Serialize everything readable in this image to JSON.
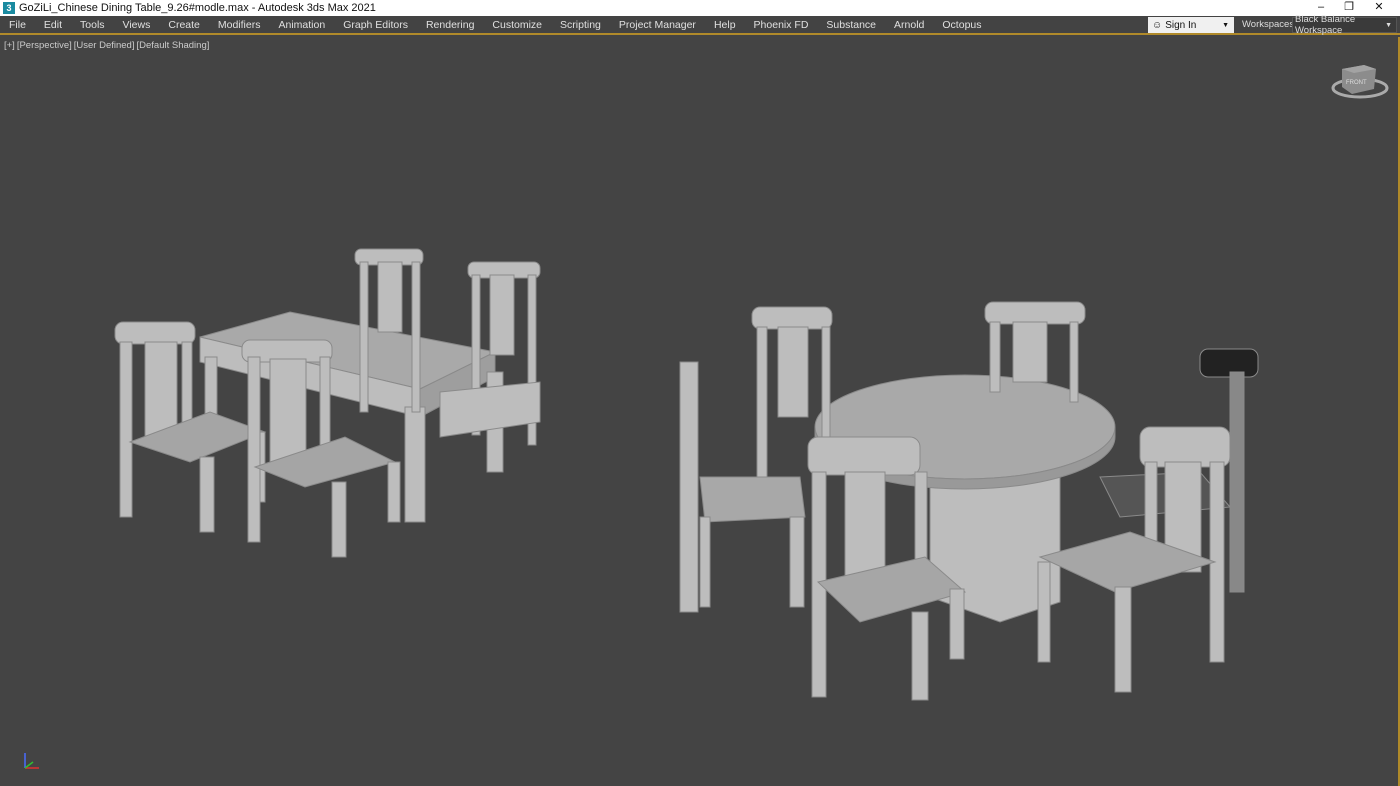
{
  "titlebar": {
    "app_icon": "3",
    "title": "GoZiLi_Chinese Dining Table_9.26#modle.max - Autodesk 3ds Max 2021",
    "minimize": "–",
    "restore": "❐",
    "close": "✕"
  },
  "menu": [
    "File",
    "Edit",
    "Tools",
    "Views",
    "Create",
    "Modifiers",
    "Animation",
    "Graph Editors",
    "Rendering",
    "Customize",
    "Scripting",
    "Project Manager",
    "Help",
    "Phoenix FD",
    "Substance",
    "Arnold",
    "Octopus"
  ],
  "signin": {
    "label": "Sign In",
    "icon": "user-icon"
  },
  "workspaces": {
    "label": "Workspaces:",
    "value": "Black Balance Workspace"
  },
  "viewport": {
    "labels": [
      "[+]",
      "[Perspective]",
      "[User Defined]",
      "[Default Shading]"
    ],
    "viewcube_face": "FRONT"
  }
}
